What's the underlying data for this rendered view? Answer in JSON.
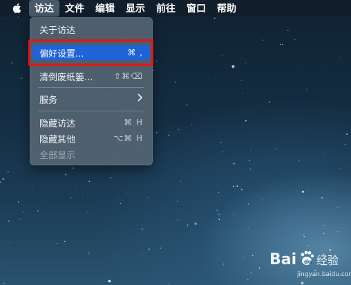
{
  "menubar": {
    "apple_icon": "apple-logo-icon",
    "items": [
      {
        "label": "访达",
        "active": true
      },
      {
        "label": "文件"
      },
      {
        "label": "编辑"
      },
      {
        "label": "显示"
      },
      {
        "label": "前往"
      },
      {
        "label": "窗口"
      },
      {
        "label": "帮助"
      }
    ]
  },
  "dropdown": {
    "about": {
      "label": "关于访达"
    },
    "preferences": {
      "label": "偏好设置...",
      "shortcut": "⌘ ,",
      "highlighted": true
    },
    "empty_trash": {
      "label": "清倒废纸篓...",
      "shortcut": "⇧⌘⌫"
    },
    "services": {
      "label": "服务"
    },
    "hide": {
      "label": "隐藏访达",
      "shortcut": "⌘ H"
    },
    "hide_others": {
      "label": "隐藏其他",
      "shortcut": "⌥⌘ H"
    },
    "show_all": {
      "label": "全部显示",
      "disabled": true
    }
  },
  "watermark": {
    "brand": "Bai",
    "brand2": "du",
    "suffix": "经验",
    "url": "jingyan.baidu.com"
  },
  "colors": {
    "highlight": "#1f63d6",
    "annotation_box": "#e8130f",
    "menubar": "#121e2a"
  }
}
